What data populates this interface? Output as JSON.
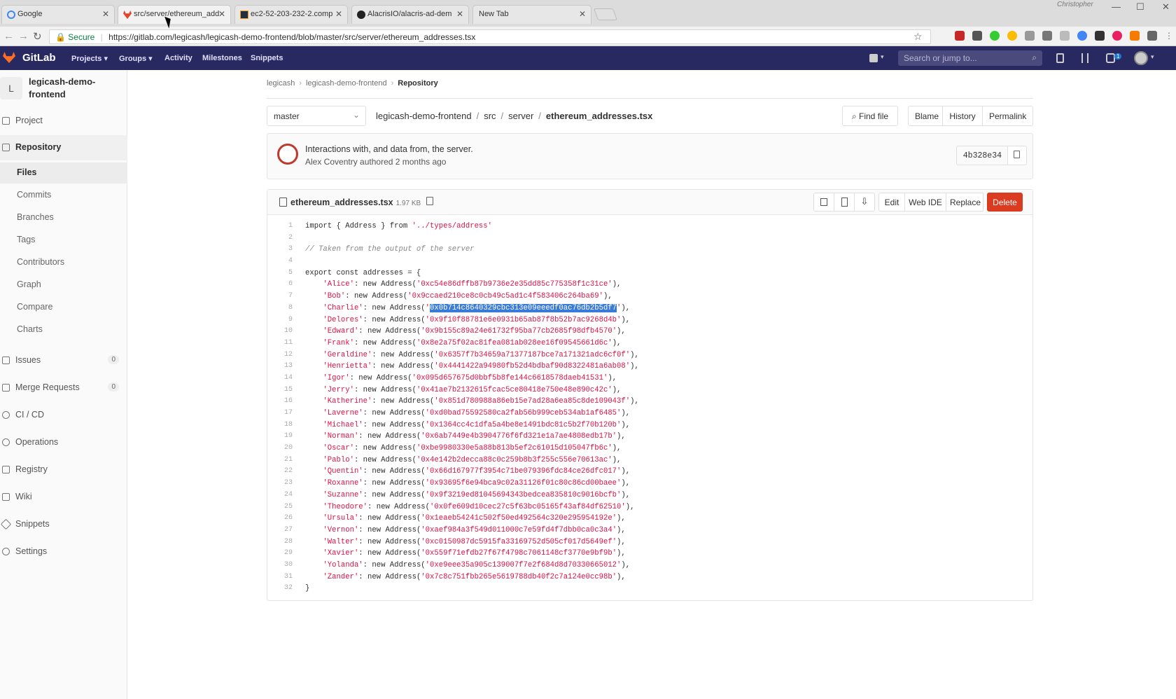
{
  "browser": {
    "tabs": [
      {
        "label": "Google",
        "active": false
      },
      {
        "label": "src/server/ethereum_add",
        "active": true
      },
      {
        "label": "ec2-52-203-232-2.comp",
        "active": false
      },
      {
        "label": "AlacrisIO/alacris-ad-dem",
        "active": false
      },
      {
        "label": "New Tab",
        "active": false
      }
    ],
    "user": "Christopher",
    "secure_label": "Secure",
    "url": "https://gitlab.com/legicash/legicash-demo-frontend/blob/master/src/server/ethereum_addresses.tsx"
  },
  "gitlab": {
    "brand": "GitLab",
    "nav": [
      "Projects",
      "Groups",
      "Activity",
      "Milestones",
      "Snippets"
    ],
    "search_placeholder": "Search or jump to...",
    "todo_count": "1"
  },
  "sidebar": {
    "avatar_letter": "L",
    "project_name": "legicash-demo-frontend",
    "items": [
      {
        "label": "Project"
      },
      {
        "label": "Repository",
        "active": true
      },
      {
        "label": "Issues",
        "count": "0"
      },
      {
        "label": "Merge Requests",
        "count": "0"
      },
      {
        "label": "CI / CD"
      },
      {
        "label": "Operations"
      },
      {
        "label": "Registry"
      },
      {
        "label": "Wiki"
      },
      {
        "label": "Snippets"
      },
      {
        "label": "Settings"
      }
    ],
    "repo_sub": [
      "Files",
      "Commits",
      "Branches",
      "Tags",
      "Contributors",
      "Graph",
      "Compare",
      "Charts"
    ]
  },
  "breadcrumb": [
    "legicash",
    "legicash-demo-frontend",
    "Repository"
  ],
  "branch": "master",
  "path": [
    "legicash-demo-frontend",
    "src",
    "server",
    "ethereum_addresses.tsx"
  ],
  "actions": {
    "find_file": "Find file",
    "blame": "Blame",
    "history": "History",
    "permalink": "Permalink"
  },
  "commit": {
    "message": "Interactions with, and data from, the server.",
    "author": "Alex Coventry",
    "authored_label": "authored 2 months ago",
    "sha": "4b328e34"
  },
  "file": {
    "name": "ethereum_addresses.tsx",
    "size": "1.97 KB",
    "buttons": {
      "edit": "Edit",
      "web_ide": "Web IDE",
      "replace": "Replace",
      "delete": "Delete"
    },
    "lines": [
      {
        "t": "import { Address } from '../types/address'"
      },
      {
        "t": ""
      },
      {
        "t": "// Taken from the output of the server",
        "c": true
      },
      {
        "t": ""
      },
      {
        "t": "export const addresses = {"
      },
      {
        "n": "Alice",
        "a": "0xc54e86dffb87b9736e2e35dd85c775358f1c31ce"
      },
      {
        "n": "Bob",
        "a": "0x9ccaed210ce8c0cb49c5ad1c4f583406c264ba69"
      },
      {
        "n": "Charlie",
        "a": "0x0b714c8640329cbc313e09eeedf0ac76db2b5df7",
        "sel": true
      },
      {
        "n": "Delores",
        "a": "0x9f10f88781e6e0931b65ab87f8b52b7ac9268d4b"
      },
      {
        "n": "Edward",
        "a": "0x9b155c89a24e61732f95ba77cb2685f98dfb4570"
      },
      {
        "n": "Frank",
        "a": "0x8e2a75f02ac81fea081ab028ee16f09545661d6c"
      },
      {
        "n": "Geraldine",
        "a": "0x6357f7b34659a71377187bce7a171321adc6cf0f"
      },
      {
        "n": "Henrietta",
        "a": "0x4441422a94980fb52d4bdbaf90d8322481a6ab08"
      },
      {
        "n": "Igor",
        "a": "0x095d657675d0bbf5b8fe144c6618578daeb41531"
      },
      {
        "n": "Jerry",
        "a": "0x41ae7b2132615fcac5ce80418e750e48e890c42c"
      },
      {
        "n": "Katherine",
        "a": "0x851d780988a86eb15e7ad28a6ea85c8de109043f"
      },
      {
        "n": "Laverne",
        "a": "0xd0bad75592580ca2fab56b999ceb534ab1af6485"
      },
      {
        "n": "Michael",
        "a": "0x1364cc4c1dfa5a4be8e1491bdc81c5b2f70b120b"
      },
      {
        "n": "Norman",
        "a": "0x6ab7449e4b3904776f6fd321e1a7ae4808edb17b"
      },
      {
        "n": "Oscar",
        "a": "0xbe9980330e5a88b813b5ef2c61015d105047fb6c"
      },
      {
        "n": "Pablo",
        "a": "0x4e142b2decca88c0c259b8b3f255c556e70613ac"
      },
      {
        "n": "Quentin",
        "a": "0x66d167977f3954c71be079396fdc84ce26dfc017"
      },
      {
        "n": "Roxanne",
        "a": "0x93695f6e94bca9c02a31126f01c80c86cd00baee"
      },
      {
        "n": "Suzanne",
        "a": "0x9f3219ed81045694343bedcea835810c9016bcfb"
      },
      {
        "n": "Theodore",
        "a": "0x0fe609d10cec27c5f63bc05165f43af84df62510"
      },
      {
        "n": "Ursula",
        "a": "0x1eaeb54241c502f50ed492564c320e295954192e"
      },
      {
        "n": "Vernon",
        "a": "0xaef984a3f549d011000c7e59fd4f7dbb0ca0c3a4"
      },
      {
        "n": "Walter",
        "a": "0xc0150987dc5915fa33169752d505cf017d5649ef"
      },
      {
        "n": "Xavier",
        "a": "0x559f71efdb27f67f4798c7061148cf3770e9bf9b"
      },
      {
        "n": "Yolanda",
        "a": "0xe9eee35a905c139007f7e2f684d8d70330665012"
      },
      {
        "n": "Zander",
        "a": "0x7c8c751fbb265e5619788db40f2c7a124e0cc98b"
      },
      {
        "t": "}"
      }
    ]
  },
  "colors": {
    "header": "#292961",
    "delete": "#db3b21",
    "string": "#d14",
    "selection": "#3b7bd8"
  }
}
